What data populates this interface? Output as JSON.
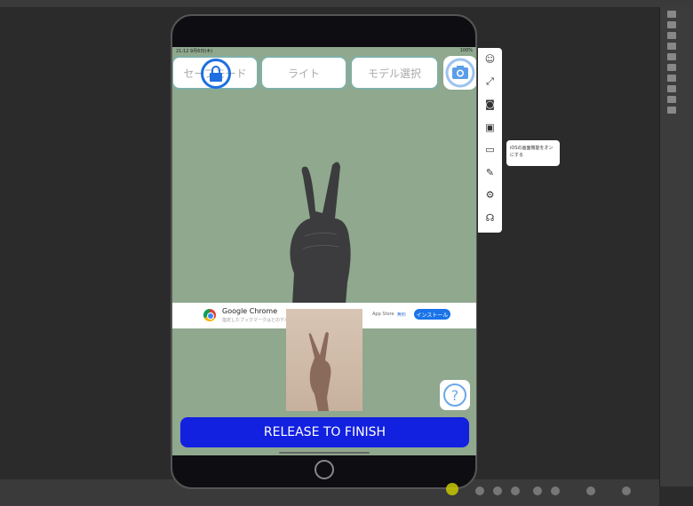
{
  "status": {
    "time": "21:12  9月6日(木)",
    "battery": "100%"
  },
  "toolbar": {
    "safe_mode": "セーフモード",
    "light": "ライト",
    "model_select": "モデル選択"
  },
  "ad": {
    "title": "Google Chrome",
    "subtitle": "指定したブックマークはどのデバ...",
    "store": "App Store",
    "price": "無料",
    "install": "インストール"
  },
  "help": "?",
  "release": "RELEASE TO FINISH",
  "tooltip": "iOSの画面機能をオンにする",
  "side_icons": [
    "fullscreen-icon",
    "camera-icon",
    "record-icon",
    "screen-icon",
    "brush-icon",
    "settings-icon",
    "headset-icon"
  ],
  "colors": {
    "accent": "#1220e0",
    "screen_bg": "#8fa88e",
    "lock": "#1e6fe0"
  }
}
